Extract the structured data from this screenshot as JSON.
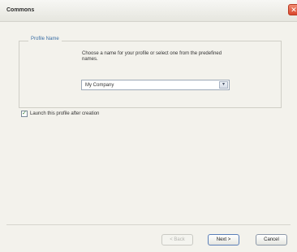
{
  "window": {
    "title": "Commons",
    "close_glyph": "✕"
  },
  "profile_group": {
    "legend": "Profile Name",
    "description": "Choose a name for your profile or select one from the predefined names.",
    "combo": {
      "value": "My Company",
      "arrow_glyph": "▾"
    }
  },
  "launch_option": {
    "checked": true,
    "check_glyph": "✓",
    "label": "Launch this profile after creation"
  },
  "buttons": {
    "back": "< Back",
    "next": "Next >",
    "cancel": "Cancel"
  }
}
